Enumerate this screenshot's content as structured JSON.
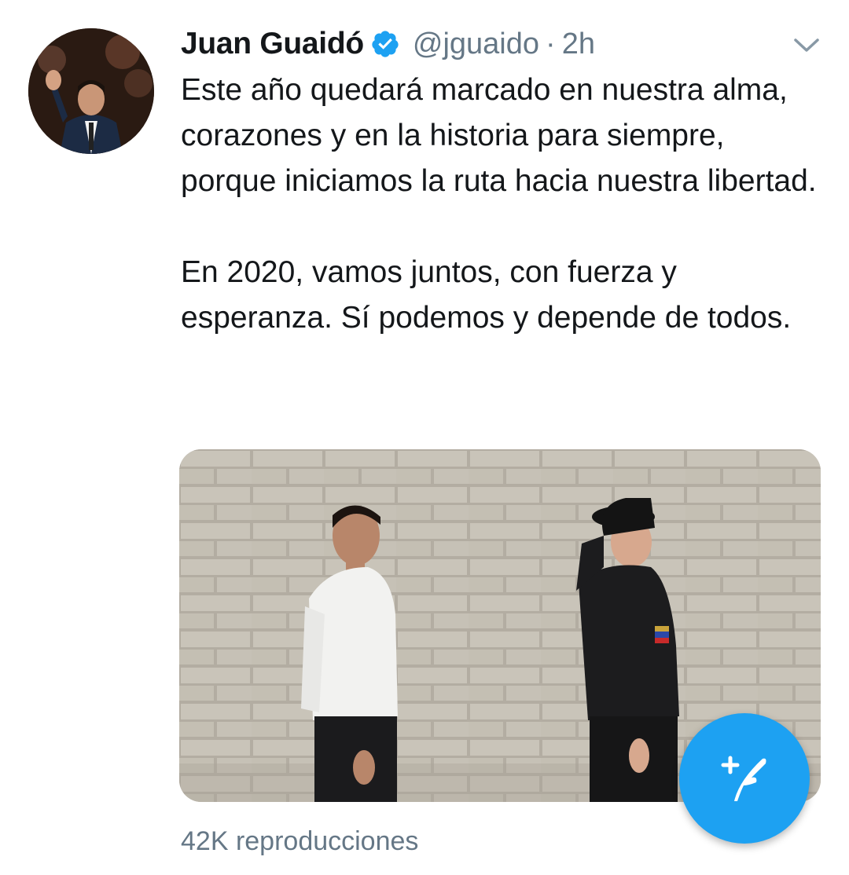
{
  "tweet": {
    "author": {
      "name": "Juan Guaidó",
      "handle": "@jguaido",
      "verified": true
    },
    "separator": "·",
    "time": "2h",
    "text": {
      "paragraph1": "Este año quedará marcado en nuestra alma, corazones y en la historia para siempre, porque iniciamos la ruta hacia nuestra libertad.",
      "paragraph2": "En 2020, vamos juntos, con fuerza y esperanza. Sí podemos y depende de todos."
    },
    "views": "42K reproducciones"
  },
  "icons": {
    "verified": "verified-badge-icon",
    "menu": "chevron-down-icon",
    "compose": "compose-tweet-icon"
  },
  "colors": {
    "accent": "#1da1f2",
    "text": "#14171a",
    "secondary": "#657786"
  }
}
